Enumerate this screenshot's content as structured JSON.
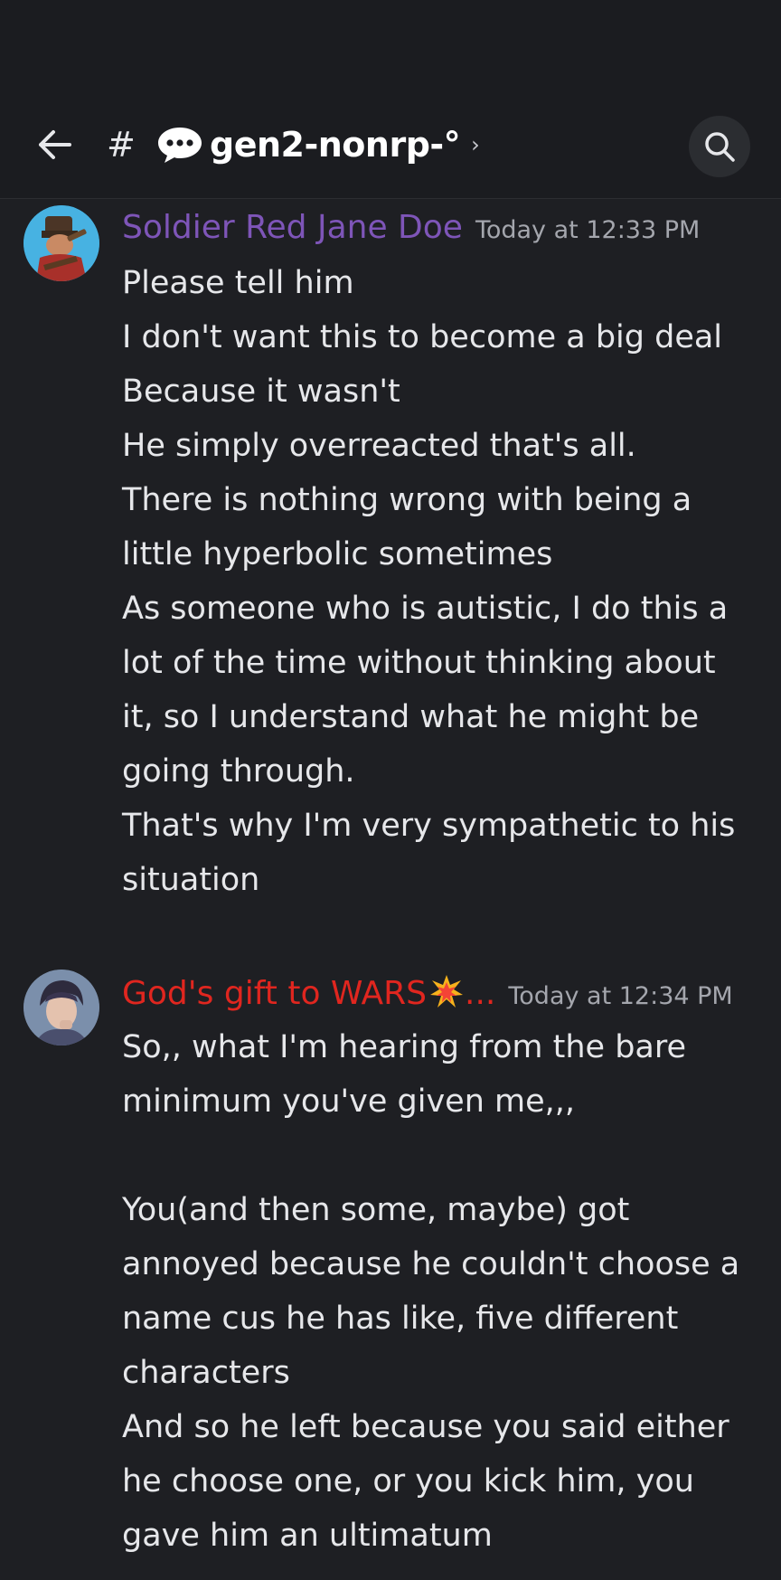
{
  "header": {
    "hash": "#",
    "channel_name": "gen2-nonrp-°",
    "chevron": "›"
  },
  "messages": [
    {
      "author": "Soldier Red Jane Doe",
      "author_color": "#7e55b8",
      "time": "Today at 12:33 PM",
      "lines": [
        "Please tell him",
        "I don't want this to become a big deal",
        "Because it wasn't",
        "He simply overreacted that's all.",
        "There is nothing wrong with being a",
        "little hyperbolic sometimes",
        "As someone who is autistic, I do this a",
        "lot of the time without thinking about",
        "it, so I understand what he might be",
        "going through.",
        "That's why I'm very sympathetic to his",
        "situation"
      ]
    },
    {
      "author": "God's gift to WARS",
      "author_suffix": "...",
      "author_color": "#e0261f",
      "time": "Today at 12:34 PM",
      "lines": [
        "So,, what I'm hearing from the bare",
        "minimum you've given me,,,",
        "",
        "You(and then some, maybe) got",
        "annoyed because he couldn't choose a",
        "name cus he has like, five different",
        "characters",
        "And so he left because you said either",
        "he choose one, or you kick him, you",
        "gave him an ultimatum"
      ]
    }
  ]
}
